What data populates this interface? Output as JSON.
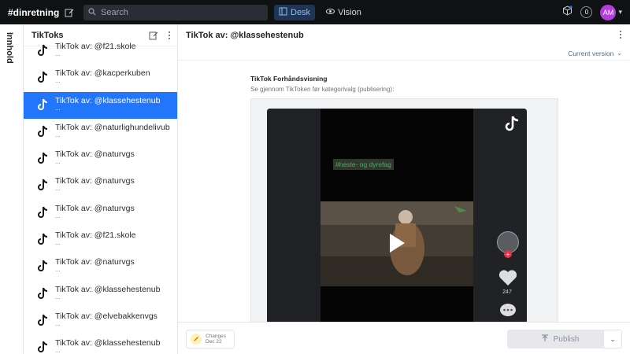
{
  "topbar": {
    "brand": "#dinretning",
    "search_placeholder": "Search",
    "nav": [
      {
        "label": "Desk",
        "active": true
      },
      {
        "label": "Vision",
        "active": false
      }
    ],
    "notification_count": "0",
    "avatar_initials": "AM"
  },
  "rail": {
    "label": "Innhold"
  },
  "list": {
    "title": "TikToks",
    "items": [
      {
        "title": "TikTok av: @f21.skole",
        "sub": "...",
        "selected": false
      },
      {
        "title": "TikTok av: @kacperkuben",
        "sub": "...",
        "selected": false
      },
      {
        "title": "TikTok av: @klassehestenub",
        "sub": "...",
        "selected": true
      },
      {
        "title": "TikTok av: @naturlighundelivub",
        "sub": "...",
        "selected": false
      },
      {
        "title": "TikTok av: @naturvgs",
        "sub": "...",
        "selected": false
      },
      {
        "title": "TikTok av: @naturvgs",
        "sub": "...",
        "selected": false
      },
      {
        "title": "TikTok av: @naturvgs",
        "sub": "...",
        "selected": false
      },
      {
        "title": "TikTok av: @f21.skole",
        "sub": "...",
        "selected": false
      },
      {
        "title": "TikTok av: @naturvgs",
        "sub": "...",
        "selected": false
      },
      {
        "title": "TikTok av: @klassehestenub",
        "sub": "...",
        "selected": false
      },
      {
        "title": "TikTok av: @elvebakkenvgs",
        "sub": "...",
        "selected": false
      },
      {
        "title": "TikTok av: @klassehestenub",
        "sub": "...",
        "selected": false
      }
    ]
  },
  "main": {
    "title": "TikTok av: @klassehestenub",
    "version": "Current version",
    "field_title": "TikTok Forhåndsvisning",
    "field_desc": "Se gjennom TikToken før kategorivalg (publisering):",
    "video": {
      "hashtag": "#heste- og dyrefag",
      "likes": "247"
    }
  },
  "footer": {
    "changes_label": "Changes",
    "changes_date": "Dec 22",
    "publish_label": "Publish"
  },
  "colors": {
    "accent": "#2276fc",
    "topbar": "#101112",
    "avatar": "#b63be0"
  },
  "icons": [
    "compose-icon",
    "search-icon",
    "desk-icon",
    "vision-eye-icon",
    "package-icon",
    "tiktok-icon",
    "kebab-icon",
    "edit-icon",
    "play-icon",
    "heart-icon",
    "comment-icon",
    "upload-icon",
    "chevron-down-icon"
  ]
}
